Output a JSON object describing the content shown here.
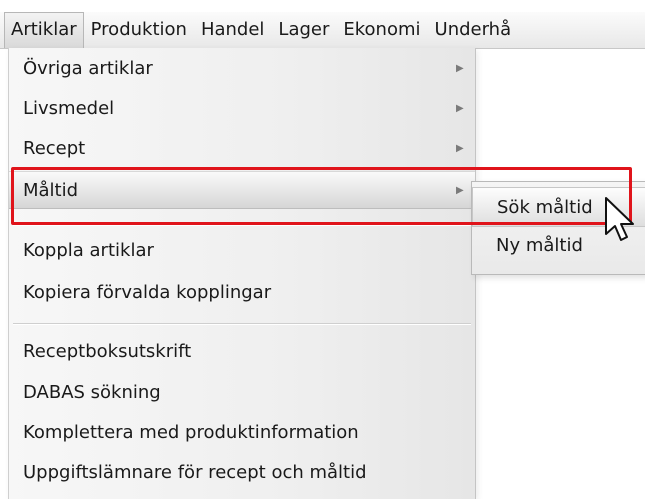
{
  "menubar": {
    "items": [
      {
        "label": "Artiklar",
        "active": true
      },
      {
        "label": "Produktion"
      },
      {
        "label": "Handel"
      },
      {
        "label": "Lager"
      },
      {
        "label": "Ekonomi"
      },
      {
        "label": "Underhå"
      }
    ]
  },
  "dropdown": {
    "items": [
      {
        "label": "Övriga artiklar",
        "has_submenu": true
      },
      {
        "label": "Livsmedel",
        "has_submenu": true
      },
      {
        "label": "Recept",
        "has_submenu": true
      },
      {
        "label": "Måltid",
        "has_submenu": true,
        "highlighted": true
      },
      {
        "label": "Koppla artiklar"
      },
      {
        "label": "Kopiera förvalda kopplingar"
      },
      {
        "label": "Receptboksutskrift"
      },
      {
        "label": "DABAS sökning"
      },
      {
        "label": "Komplettera med produktinformation"
      },
      {
        "label": "Uppgiftslämnare för recept och måltid"
      }
    ],
    "submenu_arrow": "▶"
  },
  "submenu": {
    "items": [
      {
        "label": "Sök måltid",
        "highlighted": true
      },
      {
        "label": "Ny måltid"
      }
    ]
  },
  "colors": {
    "annotation": "#e0141b",
    "menu_bg": "#efefef"
  },
  "icons": {
    "cursor": "arrow-cursor-icon",
    "submenu": "triangle-right-icon"
  }
}
